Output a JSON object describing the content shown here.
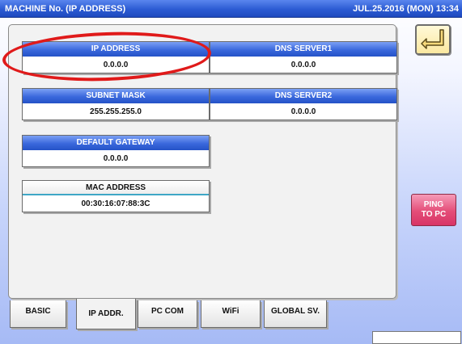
{
  "header": {
    "title": "MACHINE No. (IP ADDRESS)",
    "datetime": "JUL.25.2016 (MON) 13:34"
  },
  "fields": {
    "ip_address": {
      "label": "IP ADDRESS",
      "value": "0.0.0.0"
    },
    "subnet_mask": {
      "label": "SUBNET MASK",
      "value": "255.255.255.0"
    },
    "default_gateway": {
      "label": "DEFAULT GATEWAY",
      "value": "0.0.0.0"
    },
    "mac_address": {
      "label": "MAC ADDRESS",
      "value": "00:30:16:07:88:3C"
    },
    "dns_server1": {
      "label": "DNS SERVER1",
      "value": "0.0.0.0"
    },
    "dns_server2": {
      "label": "DNS SERVER2",
      "value": "0.0.0.0"
    }
  },
  "buttons": {
    "back_icon": "return-arrow-icon",
    "ping_line1": "PING",
    "ping_line2": "TO PC"
  },
  "tabs": [
    {
      "label": "BASIC"
    },
    {
      "label": "IP ADDR.",
      "active": true
    },
    {
      "label": "PC COM"
    },
    {
      "label": "WiFi"
    },
    {
      "label": "GLOBAL SV."
    }
  ],
  "colors": {
    "title_bar": "#2c5bd3",
    "field_header": "#3a68dc",
    "ping_button": "#e44d78",
    "highlight_oval": "#e01a1a",
    "back_button": "#fbe8a0"
  }
}
